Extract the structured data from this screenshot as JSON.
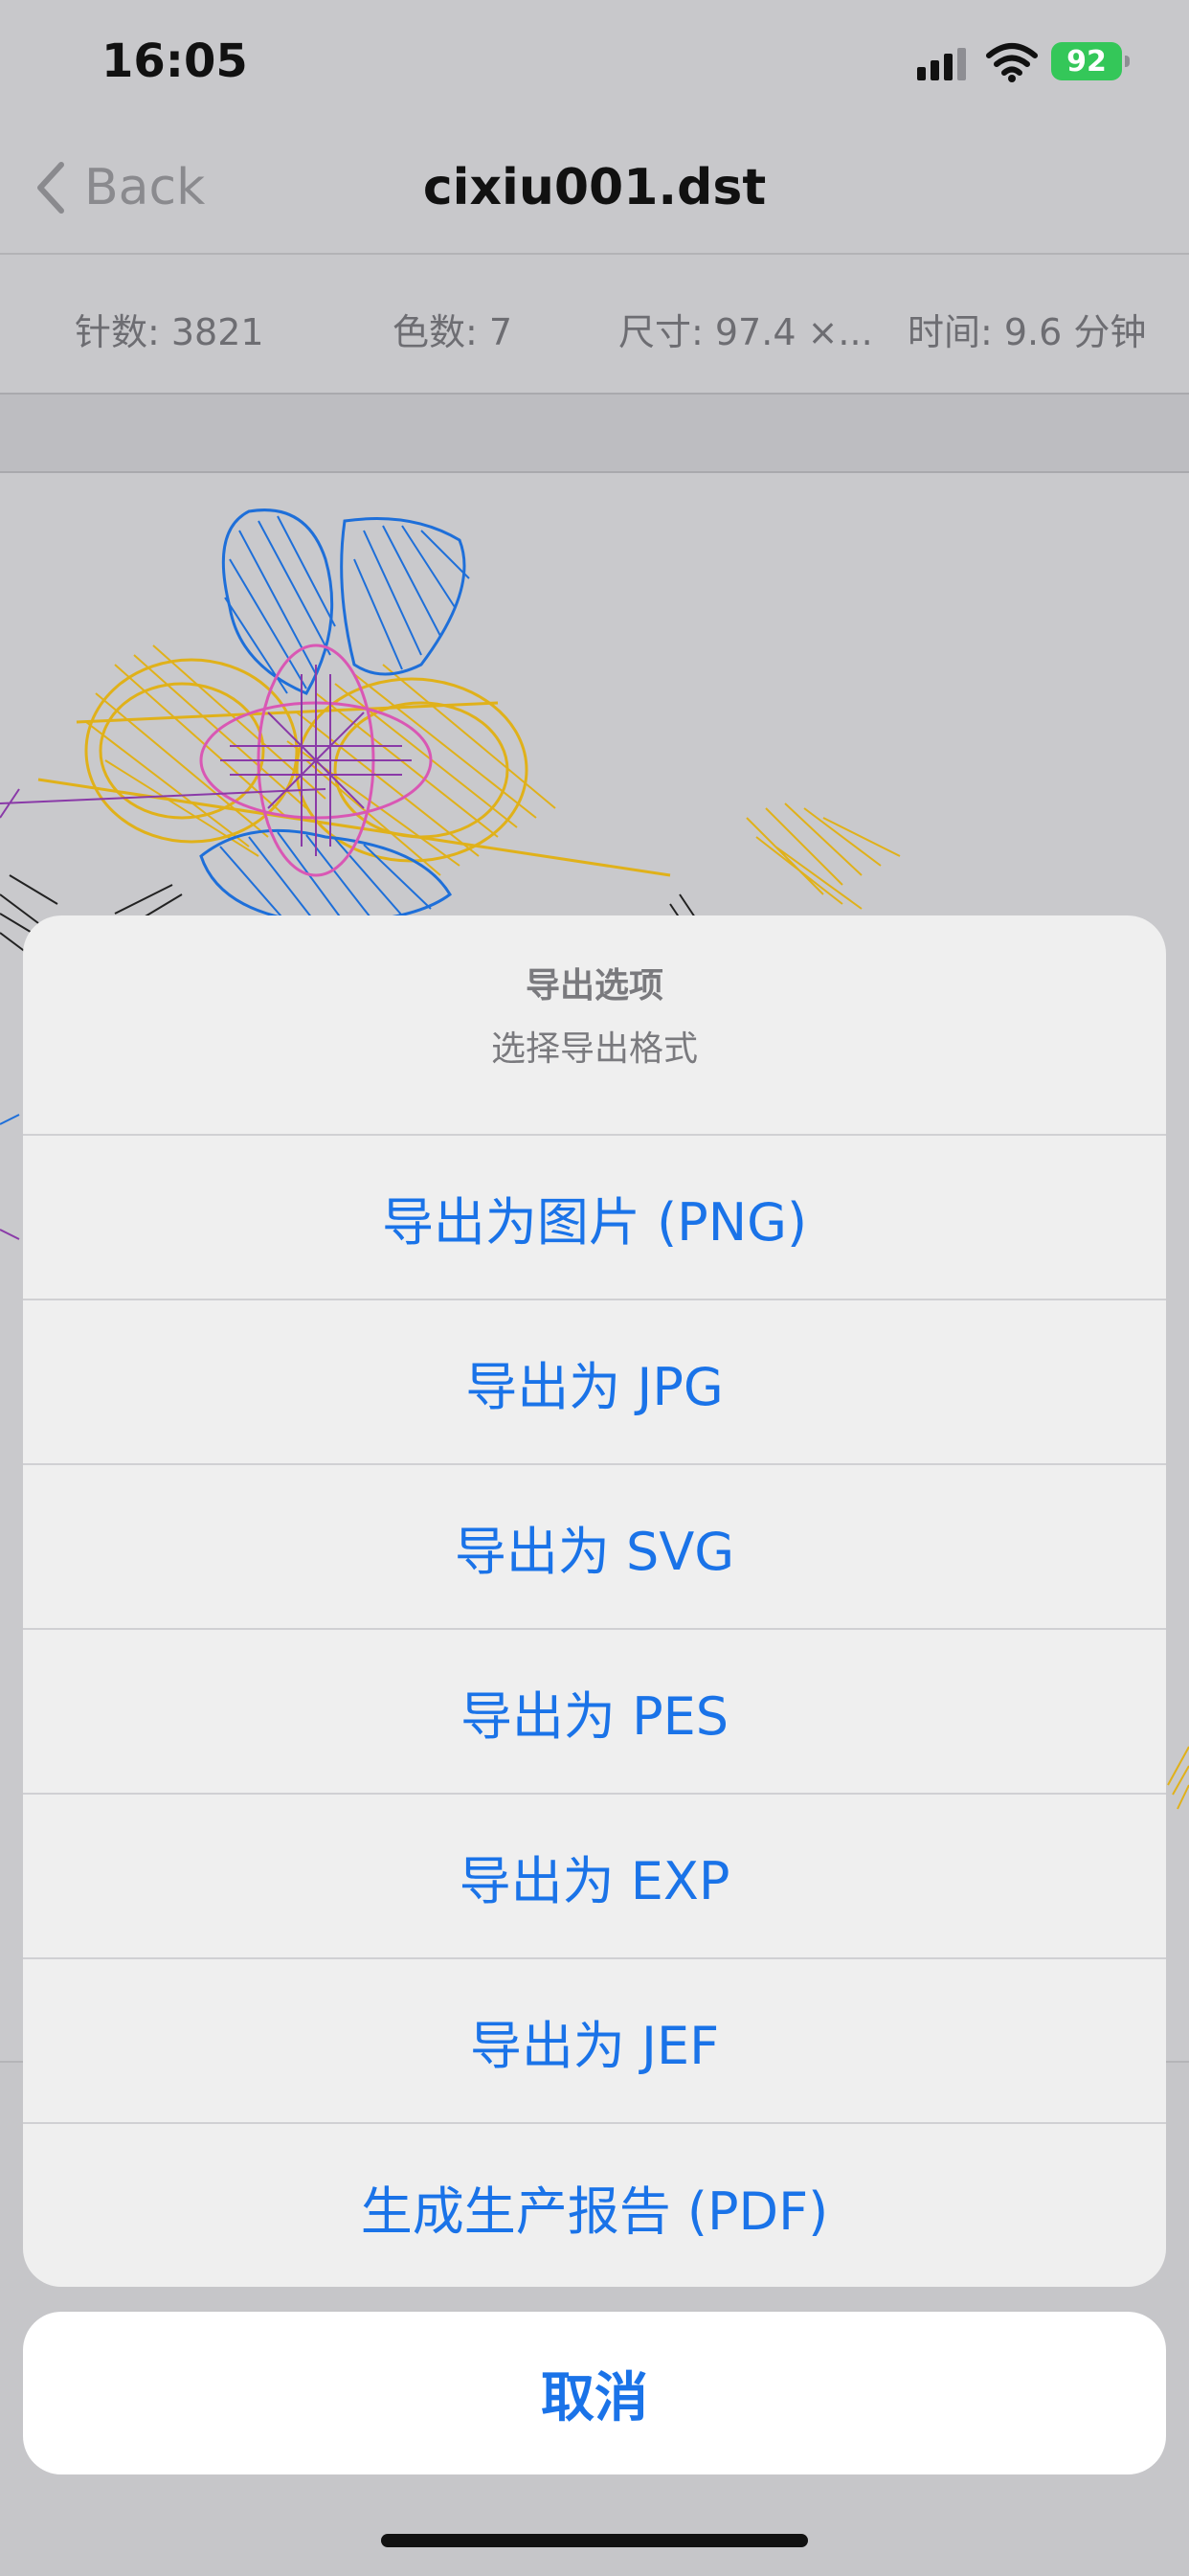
{
  "status": {
    "time": "16:05",
    "battery": "92"
  },
  "nav": {
    "back_label": "Back",
    "title": "cixiu001.dst"
  },
  "stats": [
    {
      "label": "针数: 3821"
    },
    {
      "label": "色数: 7"
    },
    {
      "label": "尺寸: 97.4 ×..."
    },
    {
      "label": "时间: 9.6 分钟"
    }
  ],
  "sheet": {
    "title": "导出选项",
    "subtitle": "选择导出格式",
    "options": [
      {
        "label": "导出为图片 (PNG)"
      },
      {
        "label": "导出为 JPG"
      },
      {
        "label": "导出为 SVG"
      },
      {
        "label": "导出为 PES"
      },
      {
        "label": "导出为 EXP"
      },
      {
        "label": "导出为 JEF"
      },
      {
        "label": "生成生产报告 (PDF)"
      }
    ],
    "cancel_label": "取消"
  },
  "colors": {
    "accent": "#1a73e8",
    "thread_blue": "#1e6fd9",
    "thread_yellow": "#e0b11a",
    "thread_pink": "#d957b4",
    "thread_purple": "#8a3aa8",
    "thread_black": "#222222",
    "battery": "#34c759"
  }
}
